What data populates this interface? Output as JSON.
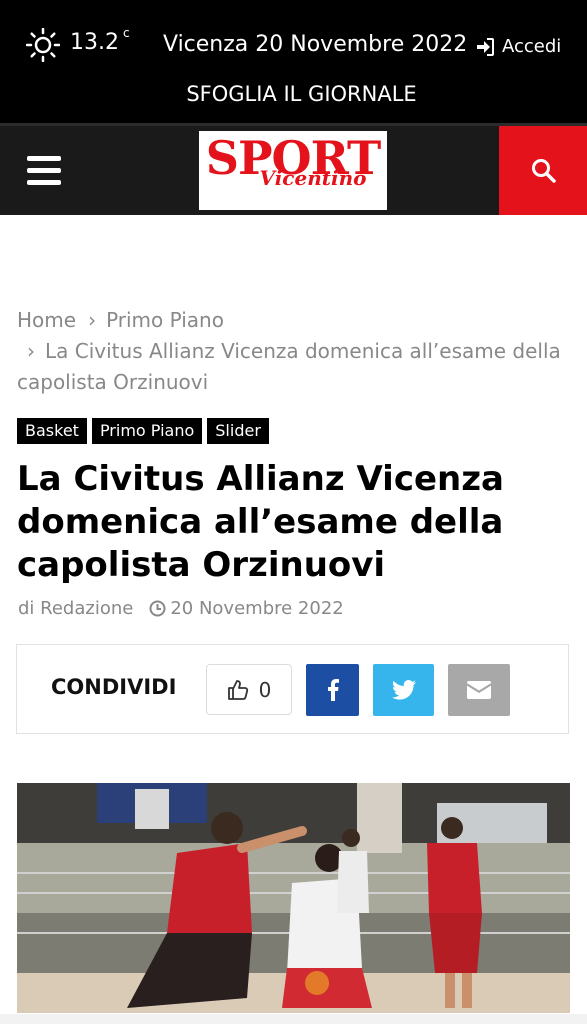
{
  "topbar": {
    "temperature": "13.2",
    "temp_unit": "c",
    "date": "Vicenza 20 Novembre 2022",
    "login_label": "Accedi",
    "sfoglia_label": "SFOGLIA IL GIORNALE"
  },
  "logo": {
    "line1": "SPORT",
    "line2": "Vicentino"
  },
  "breadcrumb": {
    "home": "Home",
    "section": "Primo Piano",
    "current": "La Civitus Allianz Vicenza domenica all’esame della capolista Orzinuovi"
  },
  "categories": [
    "Basket",
    "Primo Piano",
    "Slider"
  ],
  "article": {
    "title": "La Civitus Allianz Vicenza domenica all’esame della capolista Orzinuovi",
    "author": "di Redazione",
    "date": "20 Novembre 2022"
  },
  "share": {
    "label": "CONDIVIDI",
    "likes": "0"
  },
  "colors": {
    "brand_red": "#e3121b",
    "facebook": "#1c4fa3",
    "twitter": "#35b5ec",
    "email": "#a8a8a8"
  }
}
